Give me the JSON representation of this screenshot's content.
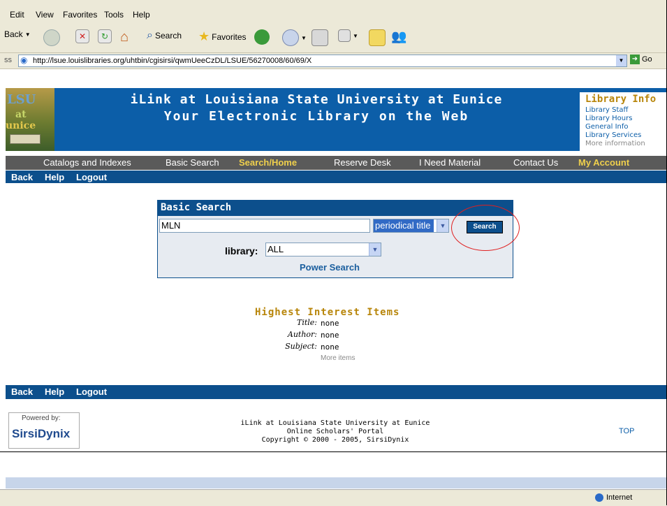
{
  "menu": [
    "Edit",
    "View",
    "Favorites",
    "Tools",
    "Help"
  ],
  "toolbar": {
    "back": "Back",
    "search": "Search",
    "favorites": "Favorites"
  },
  "address": {
    "label": "ss",
    "url": "http://lsue.louislibraries.org/uhtbin/cgisirsi/qwmUeeCzDL/LSUE/56270008/60/69/X",
    "go": "Go"
  },
  "header": {
    "logo_line1": "LSU",
    "logo_line2": "at",
    "logo_line3": "unice",
    "title_line1": "iLink at Louisiana State University at Eunice",
    "title_line2": "Your Electronic Library on the Web"
  },
  "library_info": {
    "heading": "Library Info",
    "items": [
      "Library Staff",
      "Library Hours",
      "General Info",
      "Library Services",
      "More information"
    ]
  },
  "nav": {
    "items": [
      "Catalogs and Indexes",
      "Basic Search",
      "Search/Home",
      "Reserve Desk",
      "I Need Material",
      "Contact Us",
      "My Account"
    ]
  },
  "subnav": {
    "back": "Back",
    "help": "Help",
    "logout": "Logout"
  },
  "search": {
    "heading": "Basic Search",
    "term": "MLN",
    "type": "periodical title",
    "button": "Search",
    "library_label": "library:",
    "library_value": "ALL",
    "power_search": "Power Search"
  },
  "interest": {
    "heading": "Highest Interest Items",
    "title_label": "Title:",
    "title_value": "none",
    "author_label": "Author:",
    "author_value": "none",
    "subject_label": "Subject:",
    "subject_value": "none",
    "more": "More items"
  },
  "footer": {
    "powered_by": "Powered by:",
    "brand": "SirsiDynix",
    "line1": "iLink at Louisiana State University at Eunice",
    "line2": "Online Scholars' Portal",
    "line3": "Copyright © 2000 - 2005, SirsiDynix",
    "top": "TOP"
  },
  "status": {
    "zone": "Internet"
  },
  "colors": {
    "banner": "#0c5ea8",
    "nav": "#5a5a5a",
    "subnav": "#0c4f8c",
    "accent": "#b8860b",
    "chrome": "#ECE9D8"
  }
}
